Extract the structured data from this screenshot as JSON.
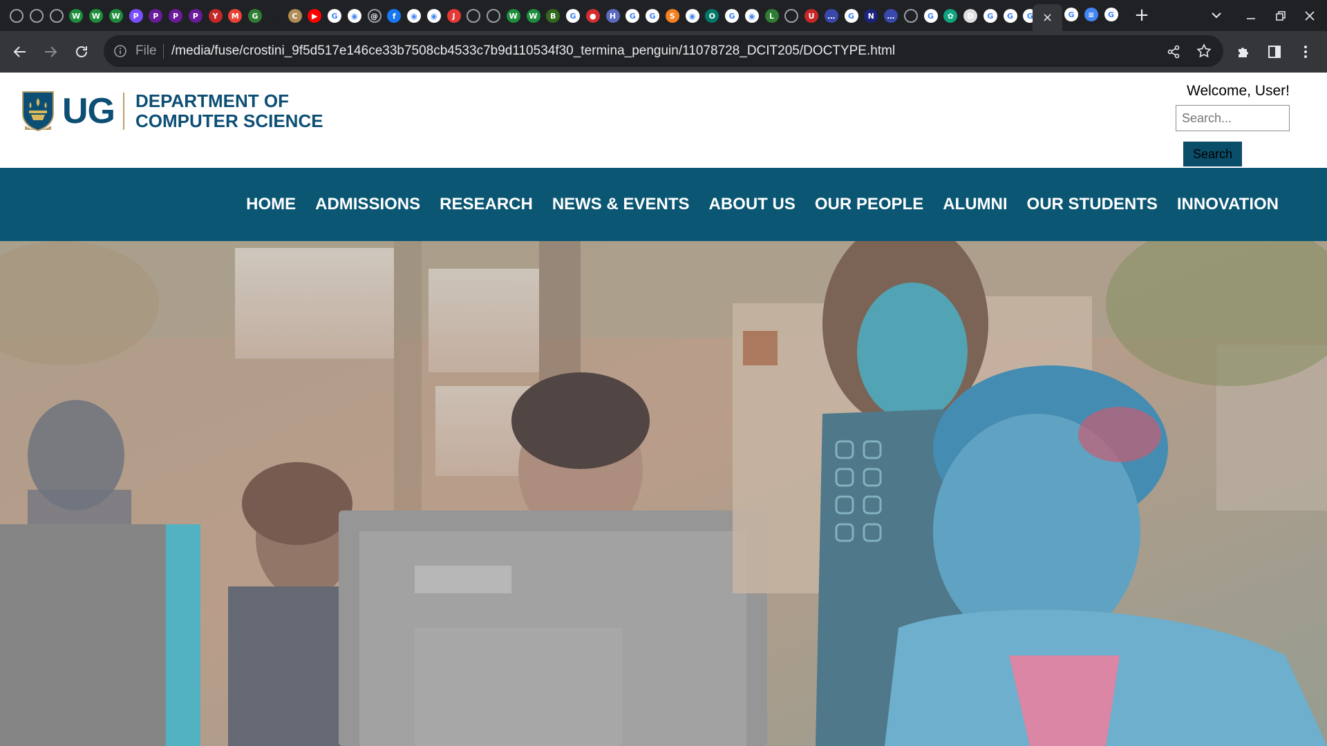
{
  "browser": {
    "active_tab_close": "×",
    "new_tab": "+",
    "address": {
      "scheme_label": "File",
      "url": "/media/fuse/crostini_9f5d517e146ce33b7508cb4533c7b9d110534f30_termina_penguin/11078728_DCIT205/DOCTYPE.html"
    },
    "favicons": [
      {
        "icon": "globe-icon",
        "color": "#5f6368",
        "glyph": ""
      },
      {
        "icon": "globe-icon",
        "color": "#5f6368",
        "glyph": ""
      },
      {
        "icon": "globe-icon",
        "color": "#5f6368",
        "glyph": ""
      },
      {
        "icon": "w-icon",
        "color": "#1e8e3e",
        "glyph": "W"
      },
      {
        "icon": "w-icon",
        "color": "#1e8e3e",
        "glyph": "W"
      },
      {
        "icon": "w-icon",
        "color": "#1e8e3e",
        "glyph": "W"
      },
      {
        "icon": "p-icon",
        "color": "#7c4dff",
        "glyph": "P"
      },
      {
        "icon": "p-icon",
        "color": "#6a1b9a",
        "glyph": "P"
      },
      {
        "icon": "p-icon",
        "color": "#6a1b9a",
        "glyph": "P"
      },
      {
        "icon": "p-icon",
        "color": "#6a1b9a",
        "glyph": "P"
      },
      {
        "icon": "figure-icon",
        "color": "#c62828",
        "glyph": "Y"
      },
      {
        "icon": "gmail-icon",
        "color": "#ea4335",
        "glyph": "M"
      },
      {
        "icon": "chat-icon",
        "color": "#2e7d32",
        "glyph": "G"
      },
      {
        "icon": "blank-icon",
        "color": "#202124",
        "glyph": ""
      },
      {
        "icon": "shield-icon",
        "color": "#b08d57",
        "glyph": "C"
      },
      {
        "icon": "youtube-icon",
        "color": "#ff0000",
        "glyph": "▶"
      },
      {
        "icon": "google-icon",
        "color": "#ffffff",
        "glyph": "G"
      },
      {
        "icon": "github-icon",
        "color": "#ffffff",
        "glyph": "◉"
      },
      {
        "icon": "fingerprint-icon",
        "color": "#5f6368",
        "glyph": "@"
      },
      {
        "icon": "facebook-icon",
        "color": "#1877f2",
        "glyph": "f"
      },
      {
        "icon": "github-icon",
        "color": "#ffffff",
        "glyph": "◉"
      },
      {
        "icon": "github-icon",
        "color": "#ffffff",
        "glyph": "◉"
      },
      {
        "icon": "jpg-png-icon",
        "color": "#e53935",
        "glyph": "J"
      },
      {
        "icon": "globe-icon",
        "color": "#5f6368",
        "glyph": ""
      },
      {
        "icon": "globe-icon",
        "color": "#5f6368",
        "glyph": ""
      },
      {
        "icon": "w-icon",
        "color": "#1e8e3e",
        "glyph": "W"
      },
      {
        "icon": "w-icon",
        "color": "#1e8e3e",
        "glyph": "W"
      },
      {
        "icon": "book-icon",
        "color": "#33691e",
        "glyph": "B"
      },
      {
        "icon": "google-icon",
        "color": "#ffffff",
        "glyph": "G"
      },
      {
        "icon": "record-icon",
        "color": "#d32f2f",
        "glyph": "●"
      },
      {
        "icon": "h-icon",
        "color": "#5c6bc0",
        "glyph": "H"
      },
      {
        "icon": "google-icon",
        "color": "#ffffff",
        "glyph": "G"
      },
      {
        "icon": "google-icon",
        "color": "#ffffff",
        "glyph": "G"
      },
      {
        "icon": "stackoverflow-icon",
        "color": "#f48024",
        "glyph": "S"
      },
      {
        "icon": "github-icon",
        "color": "#ffffff",
        "glyph": "◉"
      },
      {
        "icon": "lens-icon",
        "color": "#00796b",
        "glyph": "O"
      },
      {
        "icon": "google-icon",
        "color": "#ffffff",
        "glyph": "G"
      },
      {
        "icon": "github-icon",
        "color": "#ffffff",
        "glyph": "◉"
      },
      {
        "icon": "chart-icon",
        "color": "#2e7d32",
        "glyph": "L"
      },
      {
        "icon": "globe-icon",
        "color": "#5f6368",
        "glyph": ""
      },
      {
        "icon": "crest-icon",
        "color": "#c62828",
        "glyph": "U"
      },
      {
        "icon": "dots-icon",
        "color": "#3949ab",
        "glyph": "…"
      },
      {
        "icon": "google-icon",
        "color": "#ffffff",
        "glyph": "G"
      },
      {
        "icon": "ntu-icon",
        "color": "#1a237e",
        "glyph": "N"
      },
      {
        "icon": "dots-icon",
        "color": "#3949ab",
        "glyph": "…"
      },
      {
        "icon": "globe-icon",
        "color": "#5f6368",
        "glyph": ""
      },
      {
        "icon": "google-icon",
        "color": "#ffffff",
        "glyph": "G"
      },
      {
        "icon": "openai-icon",
        "color": "#10a37f",
        "glyph": "✿"
      },
      {
        "icon": "doc-icon",
        "color": "#e0e0e0",
        "glyph": "D"
      },
      {
        "icon": "google-icon",
        "color": "#ffffff",
        "glyph": "G"
      },
      {
        "icon": "google-icon",
        "color": "#ffffff",
        "glyph": "G"
      },
      {
        "icon": "google-icon",
        "color": "#ffffff",
        "glyph": "G"
      }
    ],
    "favicons_after": [
      {
        "icon": "google-icon",
        "color": "#ffffff",
        "glyph": "G"
      },
      {
        "icon": "google-docs-icon",
        "color": "#4285f4",
        "glyph": "≡"
      },
      {
        "icon": "google-icon",
        "color": "#ffffff",
        "glyph": "G"
      }
    ]
  },
  "site": {
    "brand": {
      "short": "UG",
      "line1": "DEPARTMENT OF",
      "line2": "COMPUTER SCIENCE"
    },
    "welcome": "Welcome, User!",
    "search": {
      "placeholder": "Search...",
      "value": "",
      "button": "Search"
    },
    "nav": [
      "HOME",
      "ADMISSIONS",
      "RESEARCH",
      "NEWS & EVENTS",
      "ABOUT US",
      "OUR PEOPLE",
      "ALUMNI",
      "OUR STUDENTS",
      "INNOVATION"
    ],
    "colors": {
      "brand_blue": "#0c4e74",
      "nav_bg": "#0a5673",
      "button_bg": "#0a4d68",
      "accent_gold": "#b9a06a"
    }
  }
}
